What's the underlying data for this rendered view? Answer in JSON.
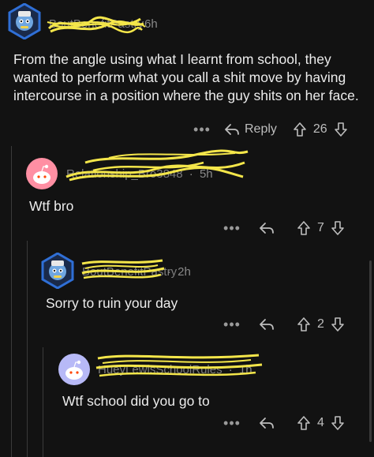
{
  "comments": [
    {
      "username": "BoutBenefitPastry",
      "time": "6h",
      "body": "From the angle using what I learnt from school, they wanted to perform what you call a shit move by having intercourse in a position where the guy shits on her face.",
      "reply_label": "Reply",
      "votes": "26",
      "more_label": "•••"
    },
    {
      "username": "Relationship_Bro3848",
      "time": "5h",
      "body": "Wtf bro",
      "votes": "7",
      "more_label": "•••"
    },
    {
      "username": "BoutBenefitPastry",
      "time": "2h",
      "body": "Sorry to ruin your day",
      "votes": "2",
      "more_label": "•••"
    },
    {
      "username": "HueyLewisSchoolRules",
      "time": "1h",
      "body": "Wtf school did you go to",
      "votes": "4",
      "more_label": "•••"
    }
  ],
  "meta_separator": "·",
  "colors": {
    "background": "#121212",
    "text": "#ececec",
    "muted": "#8a8a8a",
    "scribble": "#f4e64a",
    "pink_avatar": "#ff8fa3",
    "lavender_avatar": "#b7b9f7",
    "hex_border": "#2f6fd6"
  }
}
